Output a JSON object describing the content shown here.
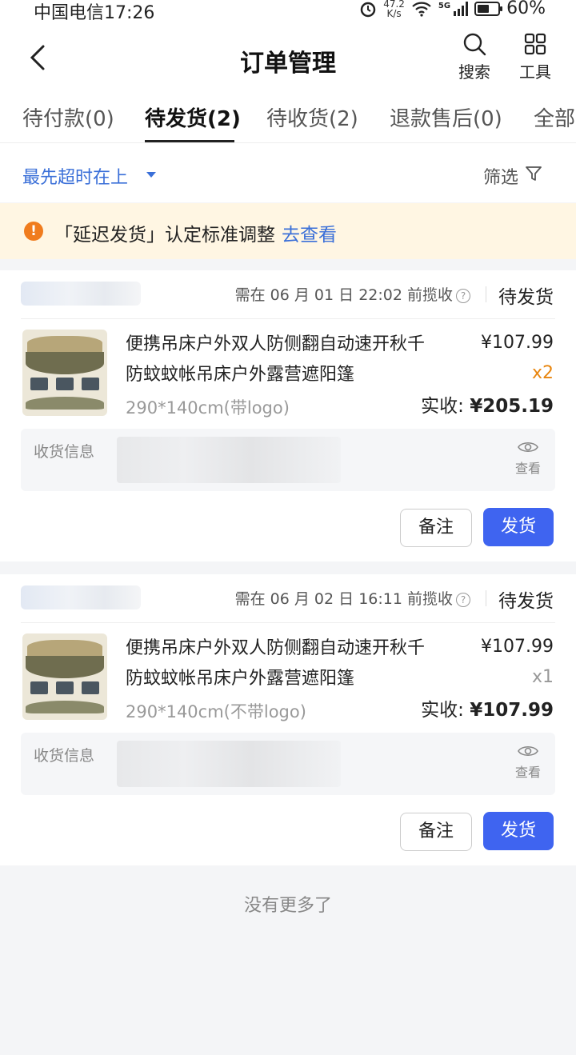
{
  "status_bar": {
    "carrier_time": "中国电信17:26",
    "net_speed_value": "47.2",
    "net_speed_unit": "K/s",
    "network": "5G",
    "battery": "60%",
    "battery_level": 0.6
  },
  "header": {
    "back_icon": "chevron-left-icon",
    "title": "订单管理",
    "search_label": "搜索",
    "tools_label": "工具"
  },
  "tabs": [
    {
      "label": "待付款(0)",
      "active": false
    },
    {
      "label": "待发货(2)",
      "active": true
    },
    {
      "label": "待收货(2)",
      "active": false
    },
    {
      "label": "退款售后(0)",
      "active": false
    },
    {
      "label": "全部",
      "active": false
    }
  ],
  "sort": {
    "label": "最先超时在上",
    "filter_label": "筛选"
  },
  "notice": {
    "text": "「延迟发货」认定标准调整",
    "link": "去查看"
  },
  "orders": [
    {
      "deadline": "需在 06 月 01 日 22:02 前揽收",
      "status": "待发货",
      "product_title_line1": "便携吊床户外双人防侧翻自动速开秋千",
      "product_title_line2": "防蚊蚊帐吊床户外露营遮阳篷",
      "spec": "290*140cm(带logo)",
      "price": "¥107.99",
      "qty": "x2",
      "paid_label": "实收:",
      "paid_amount": "¥205.19",
      "receiver_label": "收货信息",
      "view_label": "查看",
      "note_button": "备注",
      "ship_button": "发货"
    },
    {
      "deadline": "需在 06 月 02 日 16:11 前揽收",
      "status": "待发货",
      "product_title_line1": "便携吊床户外双人防侧翻自动速开秋千",
      "product_title_line2": "防蚊蚊帐吊床户外露营遮阳篷",
      "spec": "290*140cm(不带logo)",
      "price": "¥107.99",
      "qty": "x1",
      "paid_label": "实收:",
      "paid_amount": "¥107.99",
      "receiver_label": "收货信息",
      "view_label": "查看",
      "note_button": "备注",
      "ship_button": "发货"
    }
  ],
  "footer": {
    "no_more": "没有更多了"
  },
  "colors": {
    "accent": "#3f64f0",
    "link": "#3a6fd8",
    "warning": "#f07c1e",
    "qty_highlight": "#e8860f"
  }
}
